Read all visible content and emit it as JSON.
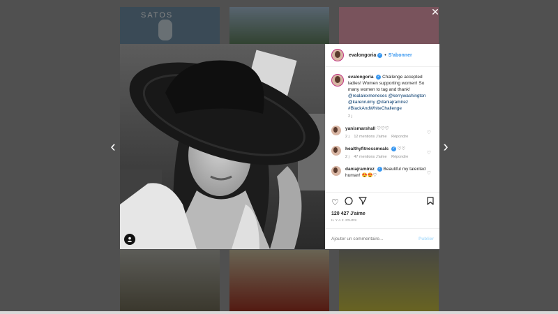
{
  "post": {
    "username": "evalongoria",
    "follow_label": "S'abonner",
    "caption": "Challenge accepted ladies! Women supporting women! So many women to tag and thank!",
    "caption_tags": "@realalexmeneses @kerrywashington @karenruimy @daniajramirez #BlackAndWhiteChallenge",
    "caption_age": "2 j",
    "likes": "120 427 J'aime",
    "posted_ago": "IL Y A 2 JOURS"
  },
  "comments": [
    {
      "username": "yanismarshall",
      "text": "♡♡♡",
      "age": "2 j",
      "likes": "12 mentions J'aime",
      "reply": "Répondre"
    },
    {
      "username": "healthyfitnessmeals",
      "text": "♡♡",
      "age": "2 j",
      "likes": "47 mentions J'aime",
      "reply": "Répondre"
    },
    {
      "username": "daniajramirez",
      "text": "Beautiful my talented human! 😍😍♡",
      "age": "",
      "likes": "",
      "reply": ""
    }
  ],
  "add_comment": {
    "placeholder": "Ajouter un commentaire...",
    "publish_label": "Publier"
  },
  "background": {
    "tile_label": "SATOS"
  },
  "icons": {
    "prev": "chevron-left-icon",
    "next": "chevron-right-icon",
    "like": "heart-icon",
    "comment": "comment-icon",
    "share": "share-icon",
    "save": "bookmark-icon",
    "tag": "user-tag-icon",
    "verified": "verified-badge-icon"
  },
  "colors": {
    "link": "#3897f0",
    "tag_text": "#00376b",
    "muted": "#8e8e8e"
  }
}
